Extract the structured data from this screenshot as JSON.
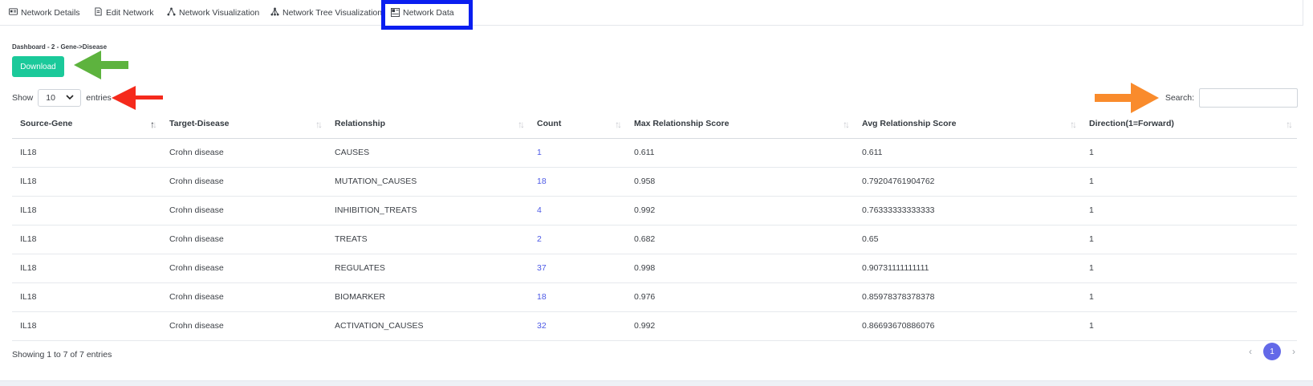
{
  "tabs": [
    {
      "label": "Network Details",
      "icon": "id-card-icon"
    },
    {
      "label": "Edit Network",
      "icon": "edit-document-icon"
    },
    {
      "label": "Network Visualization",
      "icon": "network-graph-icon"
    },
    {
      "label": "Network Tree Visualization",
      "icon": "network-tree-icon"
    },
    {
      "label": "Network Data",
      "icon": "data-table-icon",
      "active": true
    }
  ],
  "breadcrumb": "Dashboard - 2 - Gene->Disease",
  "download_label": "Download",
  "length": {
    "show_label": "Show",
    "value": "10",
    "entries_label": "entries"
  },
  "search": {
    "label": "Search:",
    "value": ""
  },
  "table": {
    "columns": [
      "Source-Gene",
      "Target-Disease",
      "Relationship",
      "Count",
      "Max Relationship Score",
      "Avg Relationship Score",
      "Direction(1=Forward)"
    ],
    "sorted_column": "Source-Gene",
    "rows": [
      [
        "IL18",
        "Crohn disease",
        "CAUSES",
        "1",
        "0.611",
        "0.611",
        "1"
      ],
      [
        "IL18",
        "Crohn disease",
        "MUTATION_CAUSES",
        "18",
        "0.958",
        "0.79204761904762",
        "1"
      ],
      [
        "IL18",
        "Crohn disease",
        "INHIBITION_TREATS",
        "4",
        "0.992",
        "0.76333333333333",
        "1"
      ],
      [
        "IL18",
        "Crohn disease",
        "TREATS",
        "2",
        "0.682",
        "0.65",
        "1"
      ],
      [
        "IL18",
        "Crohn disease",
        "REGULATES",
        "37",
        "0.998",
        "0.90731111111111",
        "1"
      ],
      [
        "IL18",
        "Crohn disease",
        "BIOMARKER",
        "18",
        "0.976",
        "0.85978378378378",
        "1"
      ],
      [
        "IL18",
        "Crohn disease",
        "ACTIVATION_CAUSES",
        "32",
        "0.992",
        "0.86693670886076",
        "1"
      ]
    ]
  },
  "info": "Showing 1 to 7 of 7 entries",
  "pagination": {
    "prev": "‹",
    "current": "1",
    "next": "›"
  },
  "colors": {
    "download": "#1bc99a",
    "active_tab_border": "#0a1ef0",
    "link": "#4c59e6",
    "page_active": "#6369e8",
    "arrow_green": "#5db33e",
    "arrow_red": "#f52a1c",
    "arrow_orange": "#f98b2c"
  }
}
